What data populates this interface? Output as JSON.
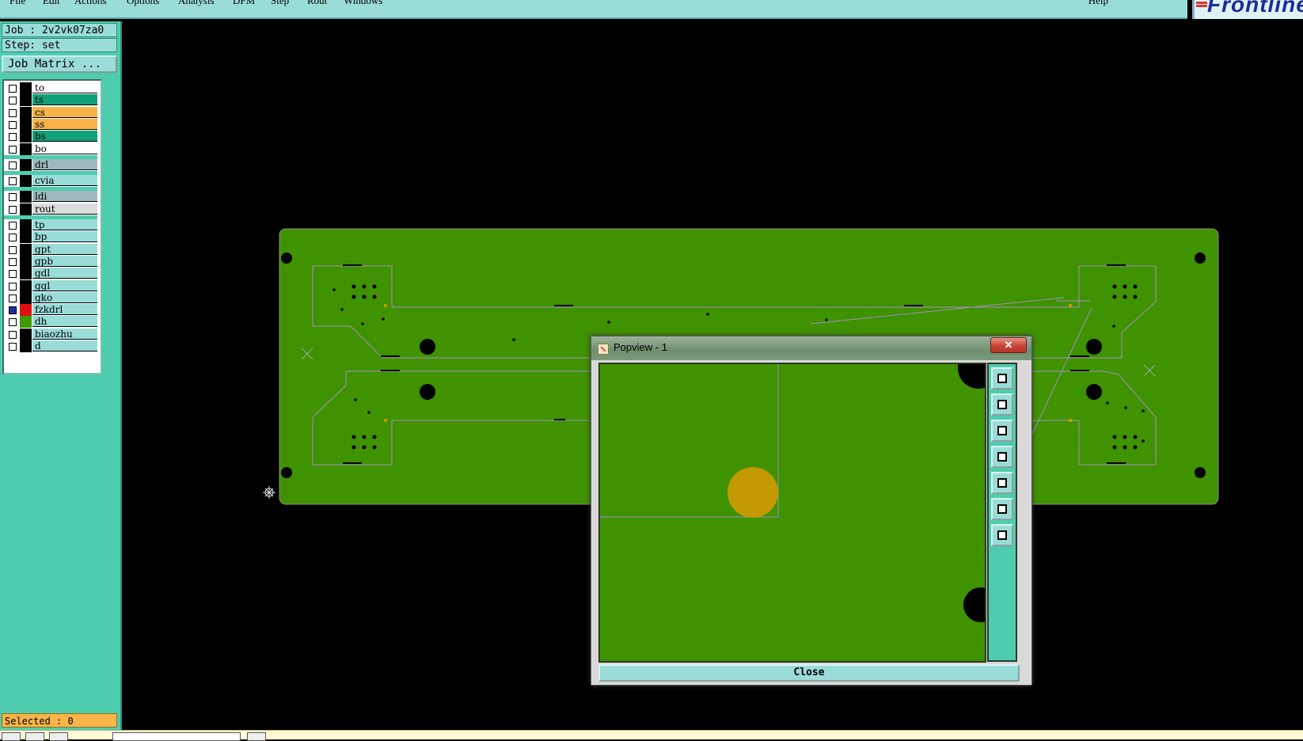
{
  "menubar": {
    "items": [
      "File",
      "Edit",
      "Actions",
      "Options",
      "Analysis",
      "DFM",
      "Step",
      "Rout",
      "Windows"
    ],
    "help": "Help",
    "brand": "Frontline"
  },
  "job": {
    "job_text": "Job : 2v2vk07za0",
    "step_text": "Step: set",
    "matrix_button": "Job Matrix ...",
    "selected_text": "Selected : 0"
  },
  "layers": [
    {
      "name": "to",
      "color": "#ffffff",
      "swatch": "#000000",
      "active": false
    },
    {
      "name": "ts",
      "color": "#12a07a",
      "swatch": "#000000",
      "active": false
    },
    {
      "name": "cs",
      "color": "#f8b44a",
      "swatch": "#000000",
      "active": false
    },
    {
      "name": "ss",
      "color": "#f8b44a",
      "swatch": "#000000",
      "active": false
    },
    {
      "name": "bs",
      "color": "#12a07a",
      "swatch": "#000000",
      "active": false
    },
    {
      "name": "bo",
      "color": "#ffffff",
      "swatch": "#000000",
      "active": false
    },
    {
      "name": "drl",
      "color": "#9fb8bc",
      "swatch": "#000000",
      "active": false
    },
    {
      "name": "cvia",
      "color": "#9adcd8",
      "swatch": "#000000",
      "active": false
    },
    {
      "name": "ldi",
      "color": "#9fb8bc",
      "swatch": "#000000",
      "active": false
    },
    {
      "name": "rout",
      "color": "#dcdcdc",
      "swatch": "#000000",
      "active": false
    },
    {
      "name": "tp",
      "color": "#9adcd8",
      "swatch": "#000000",
      "active": false
    },
    {
      "name": "bp",
      "color": "#9adcd8",
      "swatch": "#000000",
      "active": false
    },
    {
      "name": "gpt",
      "color": "#9adcd8",
      "swatch": "#000000",
      "active": false
    },
    {
      "name": "gpb",
      "color": "#9adcd8",
      "swatch": "#000000",
      "active": false
    },
    {
      "name": "gdl",
      "color": "#9adcd8",
      "swatch": "#000000",
      "active": false
    },
    {
      "name": "ggl",
      "color": "#9adcd8",
      "swatch": "#000000",
      "active": false
    },
    {
      "name": "gko",
      "color": "#9adcd8",
      "swatch": "#000000",
      "active": false
    },
    {
      "name": "fzkdrl",
      "color": "#9adcd8",
      "swatch": "#e01010",
      "active": true
    },
    {
      "name": "dh",
      "color": "#9adcd8",
      "swatch": "#3a9a00",
      "active": false
    },
    {
      "name": "biaozhu",
      "color": "#9adcd8",
      "swatch": "#000000",
      "active": false
    },
    {
      "name": "d",
      "color": "#9adcd8",
      "swatch": "#000000",
      "active": false
    }
  ],
  "popview": {
    "title": "Popview - 1",
    "close_x": "✕",
    "close_button": "Close",
    "tools": [
      "zoom-home-icon",
      "pan-up-icon",
      "pan-down-icon",
      "pan-left-icon",
      "pan-right-icon",
      "zoom-fit-icon",
      "zoom-center-icon"
    ]
  },
  "colors": {
    "board": "#3f9200",
    "panel": "#4ecdae",
    "menubar": "#9adcd8",
    "outline": "#a98cc8",
    "pad": "#c39a00"
  }
}
